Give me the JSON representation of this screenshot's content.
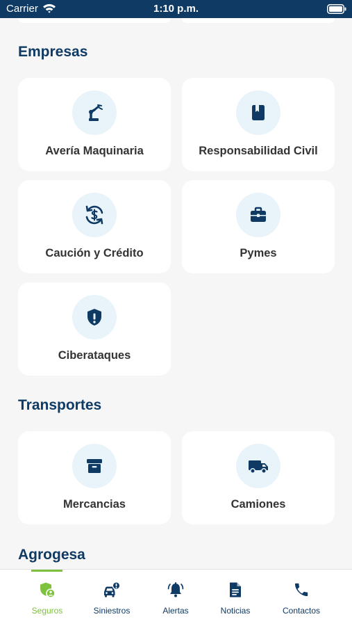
{
  "status_bar": {
    "carrier": "Carrier",
    "time": "1:10 p.m."
  },
  "sections": {
    "empresas": {
      "title": "Empresas",
      "cards": [
        "Avería Maquinaria",
        "Responsabilidad Civil",
        "Caución y Crédito",
        "Pymes",
        "Ciberataques"
      ]
    },
    "transportes": {
      "title": "Transportes",
      "cards": [
        "Mercancias",
        "Camiones"
      ]
    },
    "agrogesa": {
      "title": "Agrogesa"
    }
  },
  "tab_bar": {
    "active_tab": "Seguros",
    "tabs": [
      {
        "label": "Seguros",
        "icon": "shield-user-icon"
      },
      {
        "label": "Siniestros",
        "icon": "car-alert-icon"
      },
      {
        "label": "Alertas",
        "icon": "bell-icon"
      },
      {
        "label": "Noticias",
        "icon": "document-icon"
      },
      {
        "label": "Contactos",
        "icon": "phone-icon"
      }
    ]
  },
  "colors": {
    "primary": "#0f3a64",
    "accent": "#7dc13c",
    "background": "#f6f6f6",
    "icon_circle": "#e8f4fa"
  }
}
